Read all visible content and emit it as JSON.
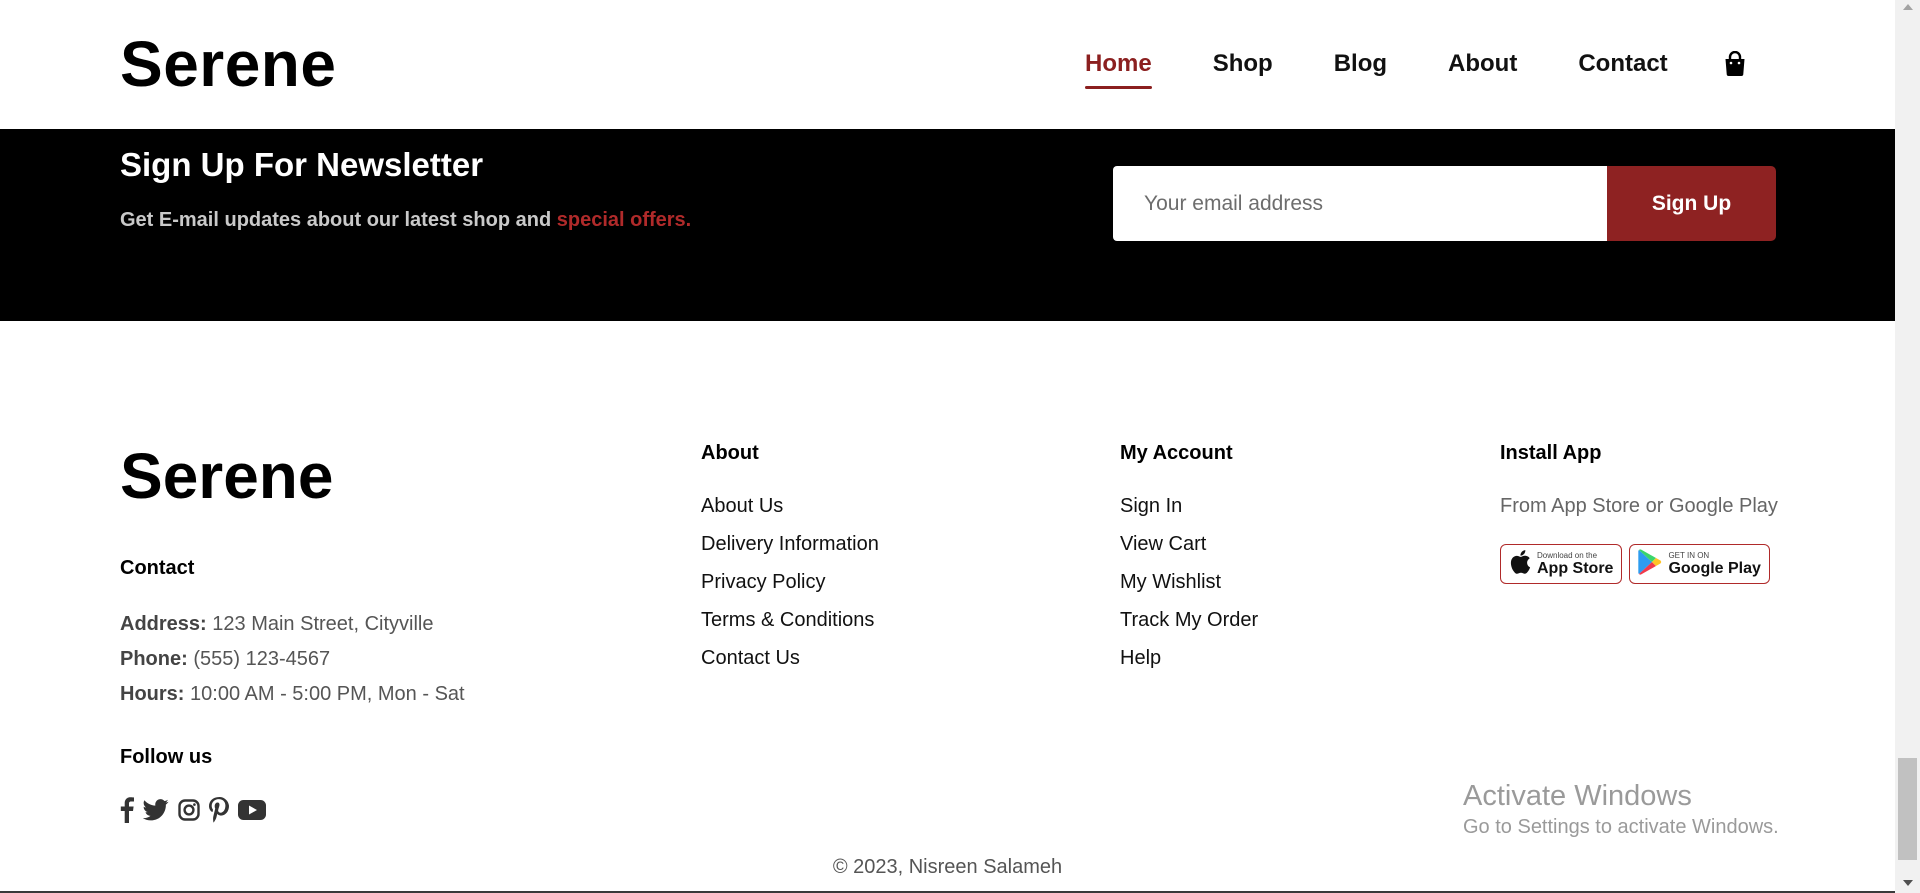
{
  "header": {
    "brand": "Serene",
    "nav": [
      {
        "label": "Home",
        "active": true
      },
      {
        "label": "Shop",
        "active": false
      },
      {
        "label": "Blog",
        "active": false
      },
      {
        "label": "About",
        "active": false
      },
      {
        "label": "Contact",
        "active": false
      }
    ],
    "cart_icon": "shopping-bag-icon"
  },
  "newsletter": {
    "title": "Sign Up For Newsletter",
    "subtitle_prefix": "Get E-mail updates about our latest shop and",
    "subtitle_accent": "special offers.",
    "email_placeholder": "Your email address",
    "email_value": "",
    "button_label": "Sign Up"
  },
  "footer": {
    "brand": "Serene",
    "contact": {
      "title": "Contact",
      "address_label": "Address:",
      "address_value": "123 Main Street, Cityville",
      "phone_label": "Phone:",
      "phone_value": "(555) 123-4567",
      "hours_label": "Hours:",
      "hours_value": "10:00 AM - 5:00 PM, Mon - Sat"
    },
    "follow": {
      "title": "Follow us",
      "icons": [
        "facebook-icon",
        "twitter-icon",
        "instagram-icon",
        "pinterest-icon",
        "youtube-icon"
      ]
    },
    "about": {
      "title": "About",
      "links": [
        "About Us",
        "Delivery Information",
        "Privacy Policy",
        "Terms & Conditions",
        "Contact Us"
      ]
    },
    "account": {
      "title": "My Account",
      "links": [
        "Sign In",
        "View Cart",
        "My Wishlist",
        "Track My Order",
        "Help"
      ]
    },
    "install": {
      "title": "Install App",
      "subtitle": "From App Store or Google Play",
      "app_store": {
        "small": "Download on the",
        "big": "App Store"
      },
      "google_play": {
        "small": "GET IN ON",
        "big": "Google Play"
      }
    },
    "copyright": "© 2023, Nisreen Salameh"
  },
  "watermark": {
    "line1": "Activate Windows",
    "line2": "Go to Settings to activate Windows."
  },
  "colors": {
    "accent": "#8e2222",
    "accent_text": "#b02a2a",
    "newsletter_bg": "#000000"
  }
}
